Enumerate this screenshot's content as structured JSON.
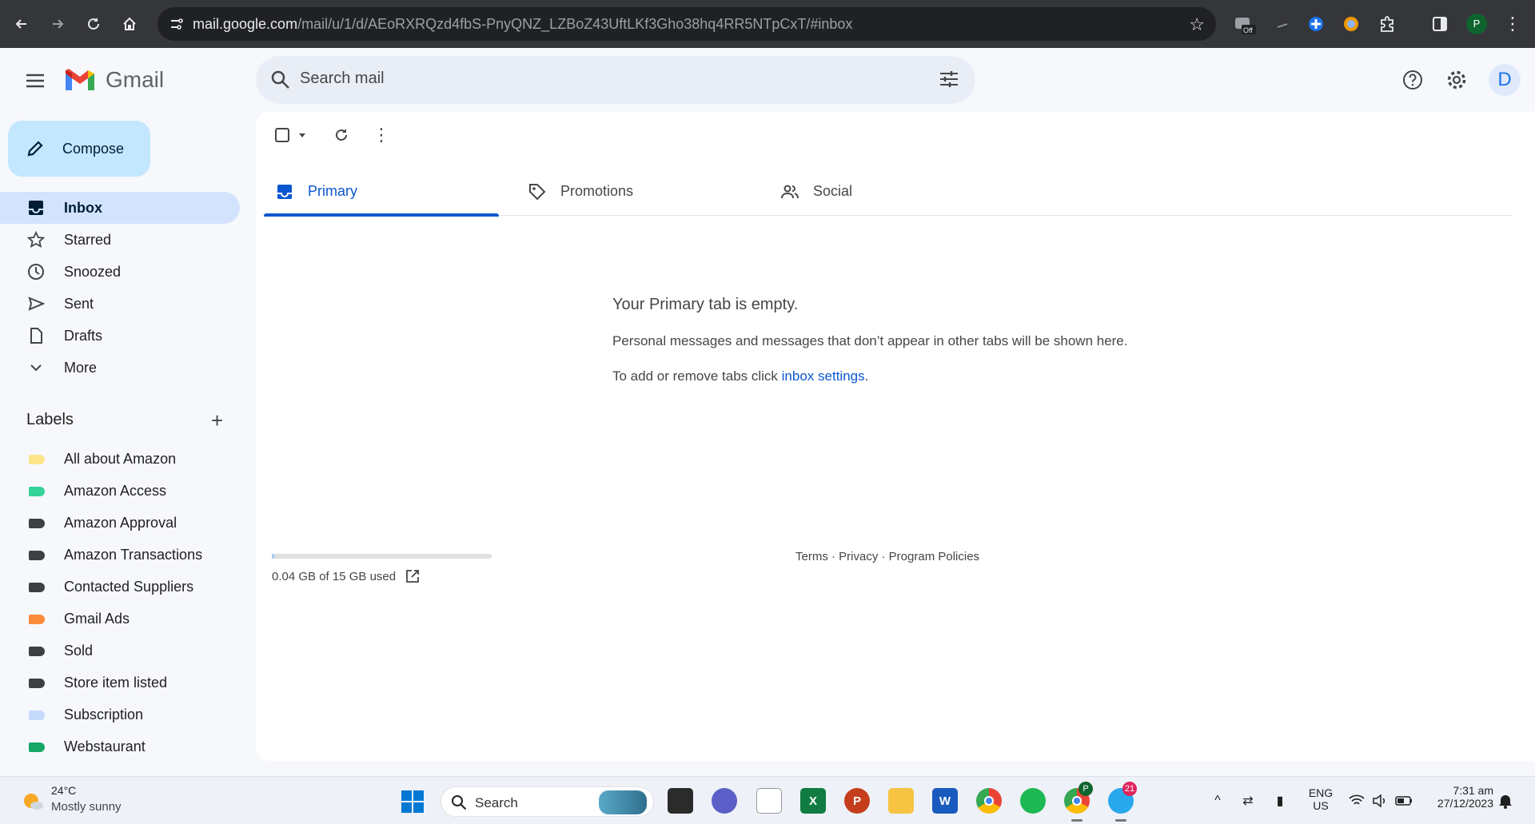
{
  "browser": {
    "url_host": "mail.google.com",
    "url_path": "/mail/u/1/d/AEoRXRQzd4fbS-PnyQNZ_LZBoZ43UftLKf3Gho38hq4RR5NTpCxT/#inbox",
    "extension_off_label": "Off",
    "profile_initial": "P"
  },
  "header": {
    "app_name": "Gmail",
    "search_placeholder": "Search mail",
    "avatar_initial": "D"
  },
  "sidebar": {
    "compose_label": "Compose",
    "items": [
      {
        "label": "Inbox",
        "icon": "inbox-icon",
        "active": true
      },
      {
        "label": "Starred",
        "icon": "star-icon"
      },
      {
        "label": "Snoozed",
        "icon": "clock-icon"
      },
      {
        "label": "Sent",
        "icon": "send-icon"
      },
      {
        "label": "Drafts",
        "icon": "draft-icon"
      },
      {
        "label": "More",
        "icon": "chevron-down-icon"
      }
    ],
    "labels_title": "Labels",
    "labels": [
      {
        "name": "All about Amazon",
        "color": "#fde68a"
      },
      {
        "name": "Amazon Access",
        "color": "#34d399"
      },
      {
        "name": "Amazon Approval",
        "color": "#3c4043"
      },
      {
        "name": "Amazon Transactions",
        "color": "#3c4043"
      },
      {
        "name": "Contacted Suppliers",
        "color": "#3c4043"
      },
      {
        "name": "Gmail Ads",
        "color": "#fb8c3a"
      },
      {
        "name": "Sold",
        "color": "#3c4043"
      },
      {
        "name": "Store item listed",
        "color": "#3c4043"
      },
      {
        "name": "Subscription",
        "color": "#c6dafc"
      },
      {
        "name": "Webstaurant",
        "color": "#16a765"
      }
    ]
  },
  "main": {
    "tabs": [
      {
        "label": "Primary",
        "icon": "inbox-tab-icon",
        "active": true
      },
      {
        "label": "Promotions",
        "icon": "tag-icon"
      },
      {
        "label": "Social",
        "icon": "people-icon"
      }
    ],
    "empty_title": "Your Primary tab is empty.",
    "empty_message": "Personal messages and messages that don’t appear in other tabs will be shown here.",
    "settings_prefix": "To add or remove tabs click ",
    "settings_link": "inbox settings",
    "settings_suffix": ".",
    "storage_text": "0.04 GB of 15 GB used",
    "storage_fraction": 0.0027,
    "footer": "Terms · Privacy · Program Policies"
  },
  "taskbar": {
    "weather_temp": "24°C",
    "weather_desc": "Mostly sunny",
    "search_label": "Search",
    "telegram_badge": "21",
    "chrome_profile": "P",
    "lang_top": "ENG",
    "lang_bottom": "US",
    "time": "7:31 am",
    "date": "27/12/2023"
  }
}
